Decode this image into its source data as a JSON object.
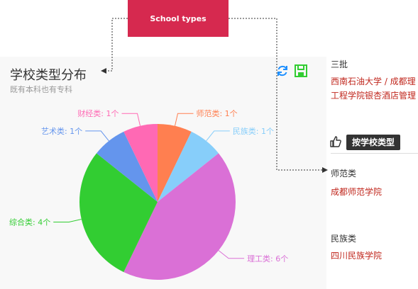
{
  "callout": {
    "label": "School types"
  },
  "chart": {
    "title": "学校类型分布",
    "subtitle": "既有本科也有专科"
  },
  "icons": {
    "refresh": "refresh-icon",
    "save": "save-icon",
    "thumb": "thumbs-up-icon"
  },
  "colors": {
    "callout_bg": "#d6294f",
    "link": "#c0271d"
  },
  "chart_data": {
    "type": "pie",
    "title": "学校类型分布",
    "subtitle": "既有本科也有专科",
    "slices": [
      {
        "label": "师范类",
        "value": 1,
        "color": "#ff7f50",
        "text": "师范类: 1个"
      },
      {
        "label": "民族类",
        "value": 1,
        "color": "#87cefa",
        "text": "民族类: 1个"
      },
      {
        "label": "理工类",
        "value": 6,
        "color": "#da70d6",
        "text": "理工类: 6个"
      },
      {
        "label": "综合类",
        "value": 4,
        "color": "#32cd32",
        "text": "综合类: 4个"
      },
      {
        "label": "艺术类",
        "value": 1,
        "color": "#6495ed",
        "text": "艺术类: 1个"
      },
      {
        "label": "财经类",
        "value": 1,
        "color": "#ff69b4",
        "text": "财经类: 1个"
      }
    ]
  },
  "side": {
    "top_heading": "三批",
    "top_line1": "西南石油大学 / 成都理",
    "top_line2": "工程学院银杏酒店管理",
    "sort_button": "按学校类型",
    "group1_heading": "师范类",
    "group1_link": "成都师范学院",
    "group2_heading": "民族类",
    "group2_link": "四川民族学院"
  }
}
